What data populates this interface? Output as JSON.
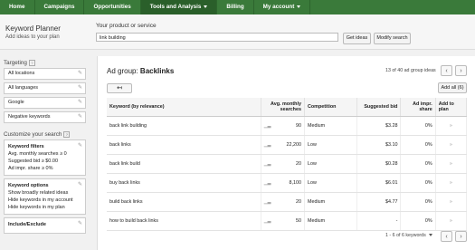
{
  "nav": {
    "items": [
      {
        "label": "Home",
        "active": false
      },
      {
        "label": "Campaigns",
        "active": false
      },
      {
        "label": "Opportunities",
        "active": false
      },
      {
        "label": "Tools and Analysis",
        "active": true
      },
      {
        "label": "Billing",
        "active": false
      },
      {
        "label": "My account",
        "active": false
      }
    ]
  },
  "header": {
    "title": "Keyword Planner",
    "subtitle": "Add ideas to your plan",
    "product_label": "Your product or service",
    "product_value": "link building",
    "get_ideas": "Get ideas",
    "modify_search": "Modify search"
  },
  "sidebar": {
    "targeting_label": "Targeting",
    "targeting": [
      "All locations",
      "All languages",
      "Google",
      "Negative keywords"
    ],
    "customize_label": "Customize your search",
    "filters_title": "Keyword filters",
    "filters": [
      "Avg. monthly searches ≥ 0",
      "Suggested bid ≥ $0.00",
      "Ad impr. share ≥ 0%"
    ],
    "options_title": "Keyword options",
    "options": [
      "Show broadly related ideas",
      "Hide keywords in my account",
      "Hide keywords in my plan"
    ],
    "include_exclude": "Include/Exclude"
  },
  "main": {
    "adgroup_prefix": "Ad group: ",
    "adgroup_name": "Backlinks",
    "count": "13 of 40 ad group ideas",
    "add_all": "Add all (6)",
    "columns": [
      "Keyword (by relevance)",
      "Avg. monthly searches",
      "Competition",
      "Suggested bid",
      "Ad impr. share",
      "Add to plan"
    ],
    "rows": [
      {
        "keyword": "back link building",
        "searches": "90",
        "competition": "Medium",
        "bid": "$3.28",
        "share": "0%"
      },
      {
        "keyword": "back links",
        "searches": "22,200",
        "competition": "Low",
        "bid": "$3.10",
        "share": "0%"
      },
      {
        "keyword": "back link build",
        "searches": "20",
        "competition": "Low",
        "bid": "$0.28",
        "share": "0%"
      },
      {
        "keyword": "buy back links",
        "searches": "8,100",
        "competition": "Low",
        "bid": "$6.01",
        "share": "0%"
      },
      {
        "keyword": "build back links",
        "searches": "20",
        "competition": "Medium",
        "bid": "$4.77",
        "share": "0%"
      },
      {
        "keyword": "how to build back links",
        "searches": "50",
        "competition": "Medium",
        "bid": "-",
        "share": "0%"
      }
    ],
    "pagination": "1 - 6 of 6 keywords"
  }
}
